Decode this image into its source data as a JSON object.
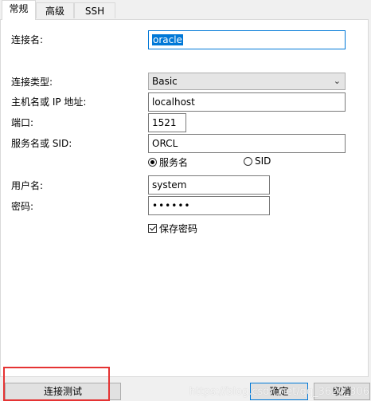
{
  "tabs": [
    {
      "label": "常规",
      "active": true
    },
    {
      "label": "高级",
      "active": false
    },
    {
      "label": "SSH",
      "active": false
    }
  ],
  "form": {
    "connection_name": {
      "label": "连接名:",
      "value": "oracle"
    },
    "connection_type": {
      "label": "连接类型:",
      "value": "Basic"
    },
    "host": {
      "label": "主机名或 IP 地址:",
      "value": "localhost"
    },
    "port": {
      "label": "端口:",
      "value": "1521"
    },
    "service": {
      "label": "服务名或 SID:",
      "value": "ORCL"
    },
    "service_options": [
      {
        "label": "服务名",
        "selected": true
      },
      {
        "label": "SID",
        "selected": false
      }
    ],
    "username": {
      "label": "用户名:",
      "value": "system"
    },
    "password": {
      "label": "密码:",
      "value": "••••••"
    },
    "save_password": {
      "label": "保存密码",
      "checked": true
    }
  },
  "footer": {
    "test_button": "连接测试",
    "ok_button": "确定",
    "cancel_button": "取消"
  },
  "watermark": "https://blog.csdn.net/qq_3620_306",
  "colors": {
    "accent": "#0078d7",
    "highlight": "#e53333"
  }
}
